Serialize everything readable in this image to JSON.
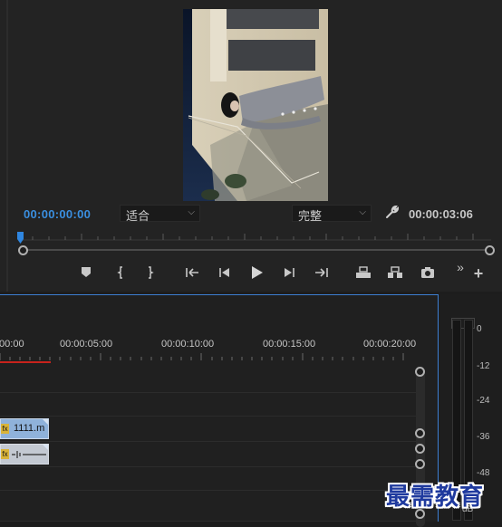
{
  "monitor": {
    "current_timecode": "00:00:00:00",
    "fit_dropdown": "适合",
    "quality_dropdown": "完整",
    "duration_timecode": "00:00:03:06",
    "controls": [
      {
        "name": "add-marker-button",
        "icon": "marker-icon"
      },
      {
        "name": "mark-in-button",
        "icon": "mark-in-icon"
      },
      {
        "name": "mark-out-button",
        "icon": "mark-out-icon"
      },
      {
        "name": "go-to-in-button",
        "icon": "go-to-in-icon"
      },
      {
        "name": "step-back-button",
        "icon": "step-back-icon"
      },
      {
        "name": "play-button",
        "icon": "play-icon"
      },
      {
        "name": "step-forward-button",
        "icon": "step-forward-icon"
      },
      {
        "name": "go-to-out-button",
        "icon": "go-to-out-icon"
      },
      {
        "name": "lift-button",
        "icon": "lift-icon"
      },
      {
        "name": "extract-button",
        "icon": "extract-icon"
      },
      {
        "name": "export-frame-button",
        "icon": "camera-icon"
      }
    ],
    "more_glyph": "»",
    "add_glyph": "+"
  },
  "timeline": {
    "ruler_labels": [
      ":00:00",
      "00:00:05:00",
      "00:00:10:00",
      "00:00:15:00",
      "00:00:20:00"
    ],
    "video_clip": {
      "fx": "fx",
      "name": "1111.m"
    },
    "audio_clip": {
      "fx": "fx",
      "name": ""
    }
  },
  "audio_meter": {
    "scale": [
      "0",
      "-12",
      "-24",
      "-36",
      "-48",
      "dB"
    ]
  },
  "watermark": "最需教育",
  "colors": {
    "accent_blue": "#3a8fe0",
    "in_out_red": "#c8231c",
    "clip_video": "#8fb2da",
    "clip_audio": "#c3c9d2"
  }
}
